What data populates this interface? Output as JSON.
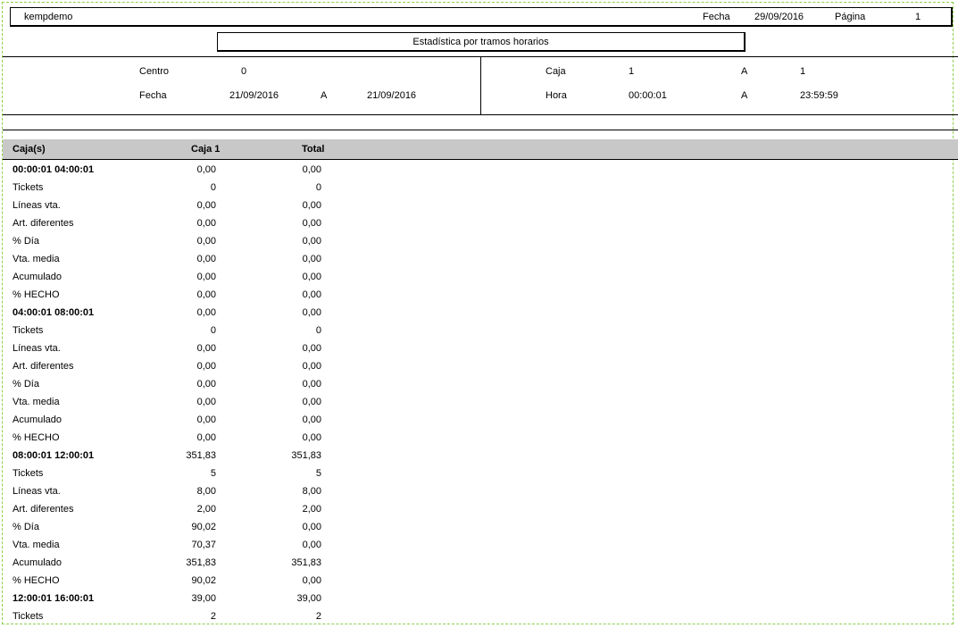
{
  "header": {
    "company": "kempdemo",
    "fecha_label": "Fecha",
    "fecha_value": "29/09/2016",
    "pagina_label": "Página",
    "pagina_value": "1",
    "report_title": "Estadística por tramos horarios"
  },
  "filters": {
    "centro_label": "Centro",
    "centro_value": "0",
    "fecha_label": "Fecha",
    "fecha_from": "21/09/2016",
    "fecha_a": "A",
    "fecha_to": "21/09/2016",
    "caja_label": "Caja",
    "caja_from": "1",
    "caja_a": "A",
    "caja_to": "1",
    "hora_label": "Hora",
    "hora_from": "00:00:01",
    "hora_a": "A",
    "hora_to": "23:59:59"
  },
  "table": {
    "columns": [
      "Caja(s)",
      "Caja 1",
      "Total"
    ],
    "rows": [
      {
        "label": "00:00:01 04:00:01",
        "c1": "0,00",
        "c2": "0,00",
        "group": true
      },
      {
        "label": "Tickets",
        "c1": "0",
        "c2": "0"
      },
      {
        "label": "Líneas vta.",
        "c1": "0,00",
        "c2": "0,00"
      },
      {
        "label": "Art. diferentes",
        "c1": "0,00",
        "c2": "0,00"
      },
      {
        "label": "% Día",
        "c1": "0,00",
        "c2": "0,00"
      },
      {
        "label": "Vta. media",
        "c1": "0,00",
        "c2": "0,00"
      },
      {
        "label": "Acumulado",
        "c1": "0,00",
        "c2": "0,00"
      },
      {
        "label": "% HECHO",
        "c1": "0,00",
        "c2": "0,00"
      },
      {
        "label": "04:00:01 08:00:01",
        "c1": "0,00",
        "c2": "0,00",
        "group": true
      },
      {
        "label": "Tickets",
        "c1": "0",
        "c2": "0"
      },
      {
        "label": "Líneas vta.",
        "c1": "0,00",
        "c2": "0,00"
      },
      {
        "label": "Art. diferentes",
        "c1": "0,00",
        "c2": "0,00"
      },
      {
        "label": "% Día",
        "c1": "0,00",
        "c2": "0,00"
      },
      {
        "label": "Vta. media",
        "c1": "0,00",
        "c2": "0,00"
      },
      {
        "label": "Acumulado",
        "c1": "0,00",
        "c2": "0,00"
      },
      {
        "label": "% HECHO",
        "c1": "0,00",
        "c2": "0,00"
      },
      {
        "label": "08:00:01 12:00:01",
        "c1": "351,83",
        "c2": "351,83",
        "group": true
      },
      {
        "label": "Tickets",
        "c1": "5",
        "c2": "5"
      },
      {
        "label": "Líneas vta.",
        "c1": "8,00",
        "c2": "8,00"
      },
      {
        "label": "Art. diferentes",
        "c1": "2,00",
        "c2": "2,00"
      },
      {
        "label": "% Día",
        "c1": "90,02",
        "c2": "0,00"
      },
      {
        "label": "Vta. media",
        "c1": "70,37",
        "c2": "0,00"
      },
      {
        "label": "Acumulado",
        "c1": "351,83",
        "c2": "351,83"
      },
      {
        "label": "% HECHO",
        "c1": "90,02",
        "c2": "0,00"
      },
      {
        "label": "12:00:01 16:00:01",
        "c1": "39,00",
        "c2": "39,00",
        "group": true
      },
      {
        "label": "Tickets",
        "c1": "2",
        "c2": "2"
      }
    ]
  }
}
